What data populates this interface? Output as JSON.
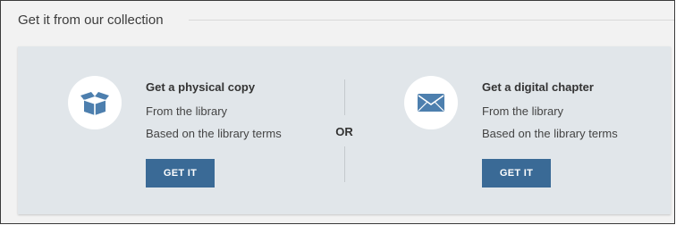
{
  "section": {
    "title": "Get it from our collection"
  },
  "options": [
    {
      "icon": "package-icon",
      "title": "Get a physical copy",
      "line1": "From the library",
      "line2": "Based on the library terms",
      "button_label": "GET IT"
    },
    {
      "icon": "envelope-icon",
      "title": "Get a digital chapter",
      "line1": "From the library",
      "line2": "Based on the library terms",
      "button_label": "GET IT"
    }
  ],
  "divider": {
    "label": "OR"
  },
  "colors": {
    "accent": "#3a6a96",
    "panel_bg": "#e1e6ea",
    "icon": "#4d7fae"
  }
}
